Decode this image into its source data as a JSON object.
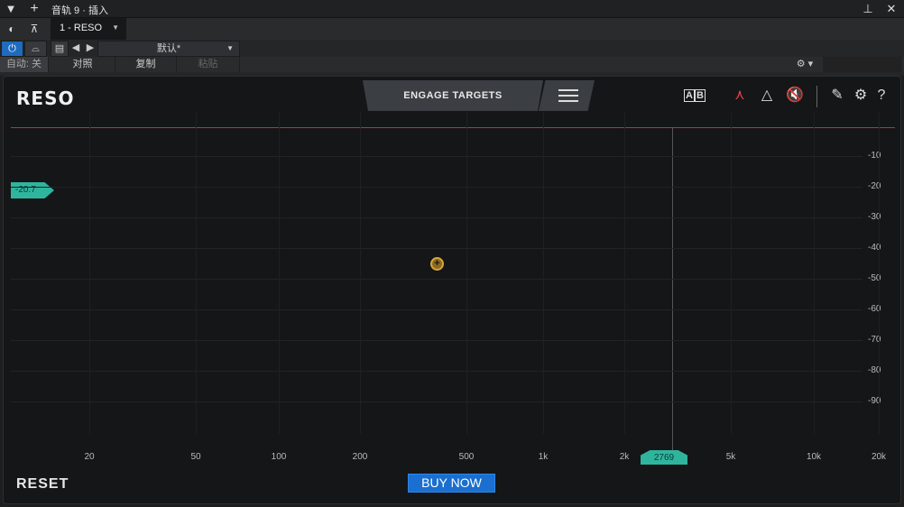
{
  "host": {
    "title": "音轨 9 · 插入",
    "preset_name": "1 - RESO",
    "preset_value": "默认*",
    "auto_label": "自动: 关",
    "compare_label": "对照",
    "copy_label": "复制",
    "paste_label": "粘贴"
  },
  "plugin": {
    "logo": "RESO",
    "engage_label": "ENGAGE TARGETS",
    "threshold_value": "-20.7",
    "frequency_value": "2769",
    "reset_label": "RESET",
    "buy_label": "BUY NOW",
    "db_labels": [
      "-10",
      "-20",
      "-30",
      "-40",
      "-50",
      "-60",
      "-70",
      "-80",
      "-90"
    ],
    "freq_labels": [
      "20",
      "50",
      "100",
      "200",
      "500",
      "1k",
      "2k",
      "5k",
      "10k",
      "20k"
    ],
    "accent": "#2fb59e",
    "buy_color": "#1a6fd0",
    "redline_color": "#c0303c"
  }
}
